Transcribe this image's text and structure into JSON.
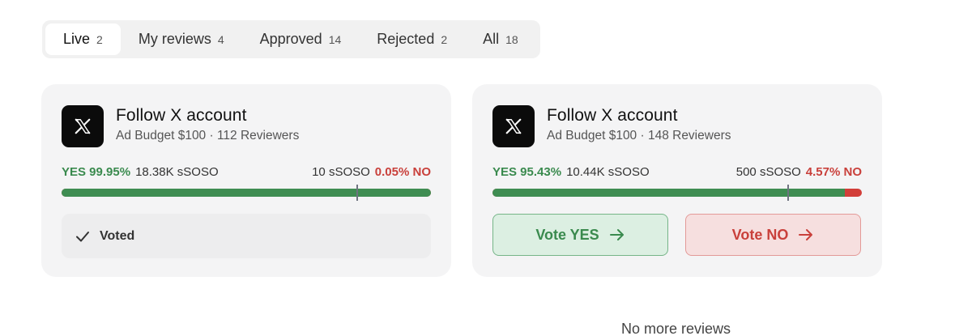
{
  "tabs": [
    {
      "label": "Live",
      "count": "2"
    },
    {
      "label": "My reviews",
      "count": "4"
    },
    {
      "label": "Approved",
      "count": "14"
    },
    {
      "label": "Rejected",
      "count": "2"
    },
    {
      "label": "All",
      "count": "18"
    }
  ],
  "active_tab": "Live",
  "cards": [
    {
      "icon": "x-logo-icon",
      "title": "Follow X account",
      "subtitle": "Ad Budget $100 · 112 Reviewers",
      "yes_pct": "YES 99.95%",
      "yes_amount": "18.38K sSOSO",
      "no_amount": "10 sSOSO",
      "no_pct": "0.05% NO",
      "yes_fraction": 0.9995,
      "threshold_fraction": 0.8,
      "status": "Voted"
    },
    {
      "icon": "x-logo-icon",
      "title": "Follow X account",
      "subtitle": "Ad Budget $100 · 148 Reviewers",
      "yes_pct": "YES 95.43%",
      "yes_amount": "10.44K sSOSO",
      "no_amount": "500 sSOSO",
      "no_pct": "4.57% NO",
      "yes_fraction": 0.9543,
      "threshold_fraction": 0.8,
      "vote_yes_label": "Vote YES",
      "vote_no_label": "Vote NO"
    }
  ],
  "footer": {
    "no_more": "No more reviews"
  },
  "colors": {
    "yes": "#3f8d52",
    "no": "#d23e39",
    "marker": "#6e7480"
  }
}
